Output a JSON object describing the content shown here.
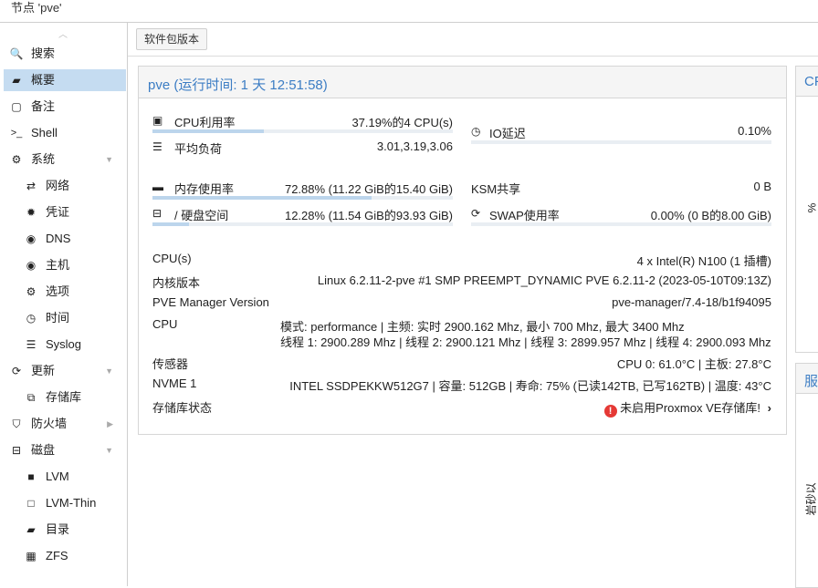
{
  "window": {
    "title": "节点 'pve'"
  },
  "toolbar": {
    "package_versions": "软件包版本"
  },
  "sidebar": {
    "items": [
      {
        "label": "搜索",
        "icon": "search-icon",
        "glyph": "🔍"
      },
      {
        "label": "概要",
        "icon": "book-icon",
        "glyph": "📘"
      },
      {
        "label": "备注",
        "icon": "note-icon",
        "glyph": "▢"
      },
      {
        "label": "Shell",
        "icon": "terminal-icon",
        "glyph": ">_"
      },
      {
        "label": "系统",
        "icon": "cogs-icon",
        "glyph": "⚙"
      },
      {
        "label": "网络",
        "icon": "exchange-icon",
        "glyph": "⇄"
      },
      {
        "label": "凭证",
        "icon": "certificate-icon",
        "glyph": "✹"
      },
      {
        "label": "DNS",
        "icon": "globe-icon",
        "glyph": "◉"
      },
      {
        "label": "主机",
        "icon": "globe-icon",
        "glyph": "◉"
      },
      {
        "label": "选项",
        "icon": "gear-icon",
        "glyph": "⚙"
      },
      {
        "label": "时间",
        "icon": "clock-icon",
        "glyph": "◷"
      },
      {
        "label": "Syslog",
        "icon": "list-icon",
        "glyph": "☰"
      },
      {
        "label": "更新",
        "icon": "refresh-icon",
        "glyph": "⟳"
      },
      {
        "label": "存储库",
        "icon": "files-icon",
        "glyph": "⧉"
      },
      {
        "label": "防火墙",
        "icon": "shield-icon",
        "glyph": "⛉"
      },
      {
        "label": "磁盘",
        "icon": "hdd-icon",
        "glyph": "⊟"
      },
      {
        "label": "LVM",
        "icon": "square-icon",
        "glyph": "■"
      },
      {
        "label": "LVM-Thin",
        "icon": "square-outline-icon",
        "glyph": "□"
      },
      {
        "label": "目录",
        "icon": "folder-icon",
        "glyph": "▰"
      },
      {
        "label": "ZFS",
        "icon": "th-large-icon",
        "glyph": "▦"
      }
    ]
  },
  "summary": {
    "title": "pve (运行时间: 1 天 12:51:58)",
    "cpu": {
      "label": "CPU利用率",
      "value": "37.19%的4 CPU(s)",
      "fraction": 0.3719
    },
    "load": {
      "label": "平均负荷",
      "value": "3.01,3.19,3.06"
    },
    "io": {
      "label": "IO延迟",
      "value": "0.10%"
    },
    "mem": {
      "label": "内存使用率",
      "value": "72.88% (11.22 GiB的15.40 GiB)",
      "fraction": 0.7288
    },
    "ksm": {
      "label": "KSM共享",
      "value": "0 B"
    },
    "disk": {
      "label": "/ 硬盘空间",
      "value": "12.28% (11.54 GiB的93.93 GiB)",
      "fraction": 0.1228
    },
    "swap": {
      "label": "SWAP使用率",
      "value": "0.00% (0 B的8.00 GiB)",
      "fraction": 0.0
    },
    "cpus": {
      "label": "CPU(s)",
      "value": "4 x Intel(R) N100 (1 插槽)"
    },
    "kernel": {
      "label": "内核版本",
      "value": "Linux 6.2.11-2-pve #1 SMP PREEMPT_DYNAMIC PVE 6.2.11-2 (2023-05-10T09:13Z)"
    },
    "pvemanager": {
      "label": "PVE Manager Version",
      "value": "pve-manager/7.4-18/b1f94095"
    },
    "cpufreq": {
      "label": "CPU",
      "line1": "模式: performance | 主频: 实时 2900.162 Mhz, 最小 700 Mhz, 最大 3400 Mhz",
      "line2": "线程 1: 2900.289 Mhz | 线程 2: 2900.121 Mhz | 线程 3: 2899.957 Mhz | 线程 4: 2900.093 Mhz"
    },
    "sensors": {
      "label": "传感器",
      "value": "CPU 0: 61.0°C | 主板: 27.8°C"
    },
    "nvme": {
      "label": "NVME 1",
      "value": "INTEL SSDPEKKW512G7 | 容量: 512GB | 寿命: 75% (已读142TB, 已写162TB) | 温度: 43°C"
    },
    "repo": {
      "label": "存储库状态",
      "value": "未启用Proxmox VE存储库!"
    }
  },
  "right": {
    "panel1_title": "CP",
    "percent": "%",
    "panel2_title": "服",
    "vertical_text": "岩砂以"
  },
  "colors": {
    "accent": "#3c7dc4",
    "selected": "#c5dcf1",
    "bar_fill": "#bcd5ec",
    "warning": "#e53935"
  }
}
